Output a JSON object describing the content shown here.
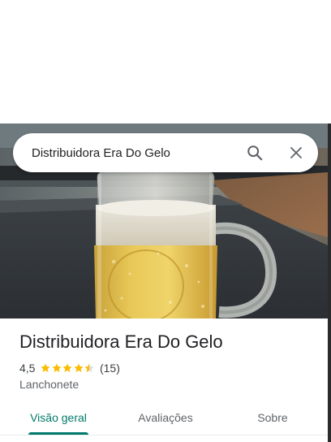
{
  "search": {
    "value": "Distribuidora Era Do Gelo",
    "search_icon": "search-icon",
    "close_icon": "close-icon"
  },
  "hero": {
    "photo": "beer-mug-photo"
  },
  "place": {
    "name": "Distribuidora Era Do Gelo",
    "rating": "4,5",
    "rating_value": 4.5,
    "reviews": "(15)",
    "category": "Lanchonete"
  },
  "tabs": [
    {
      "label": "Visão geral",
      "active": true
    },
    {
      "label": "Avaliações",
      "active": false
    },
    {
      "label": "Sobre",
      "active": false
    }
  ],
  "colors": {
    "accent": "#00796b",
    "star": "#fbbc04",
    "star_empty": "#dadce0"
  }
}
